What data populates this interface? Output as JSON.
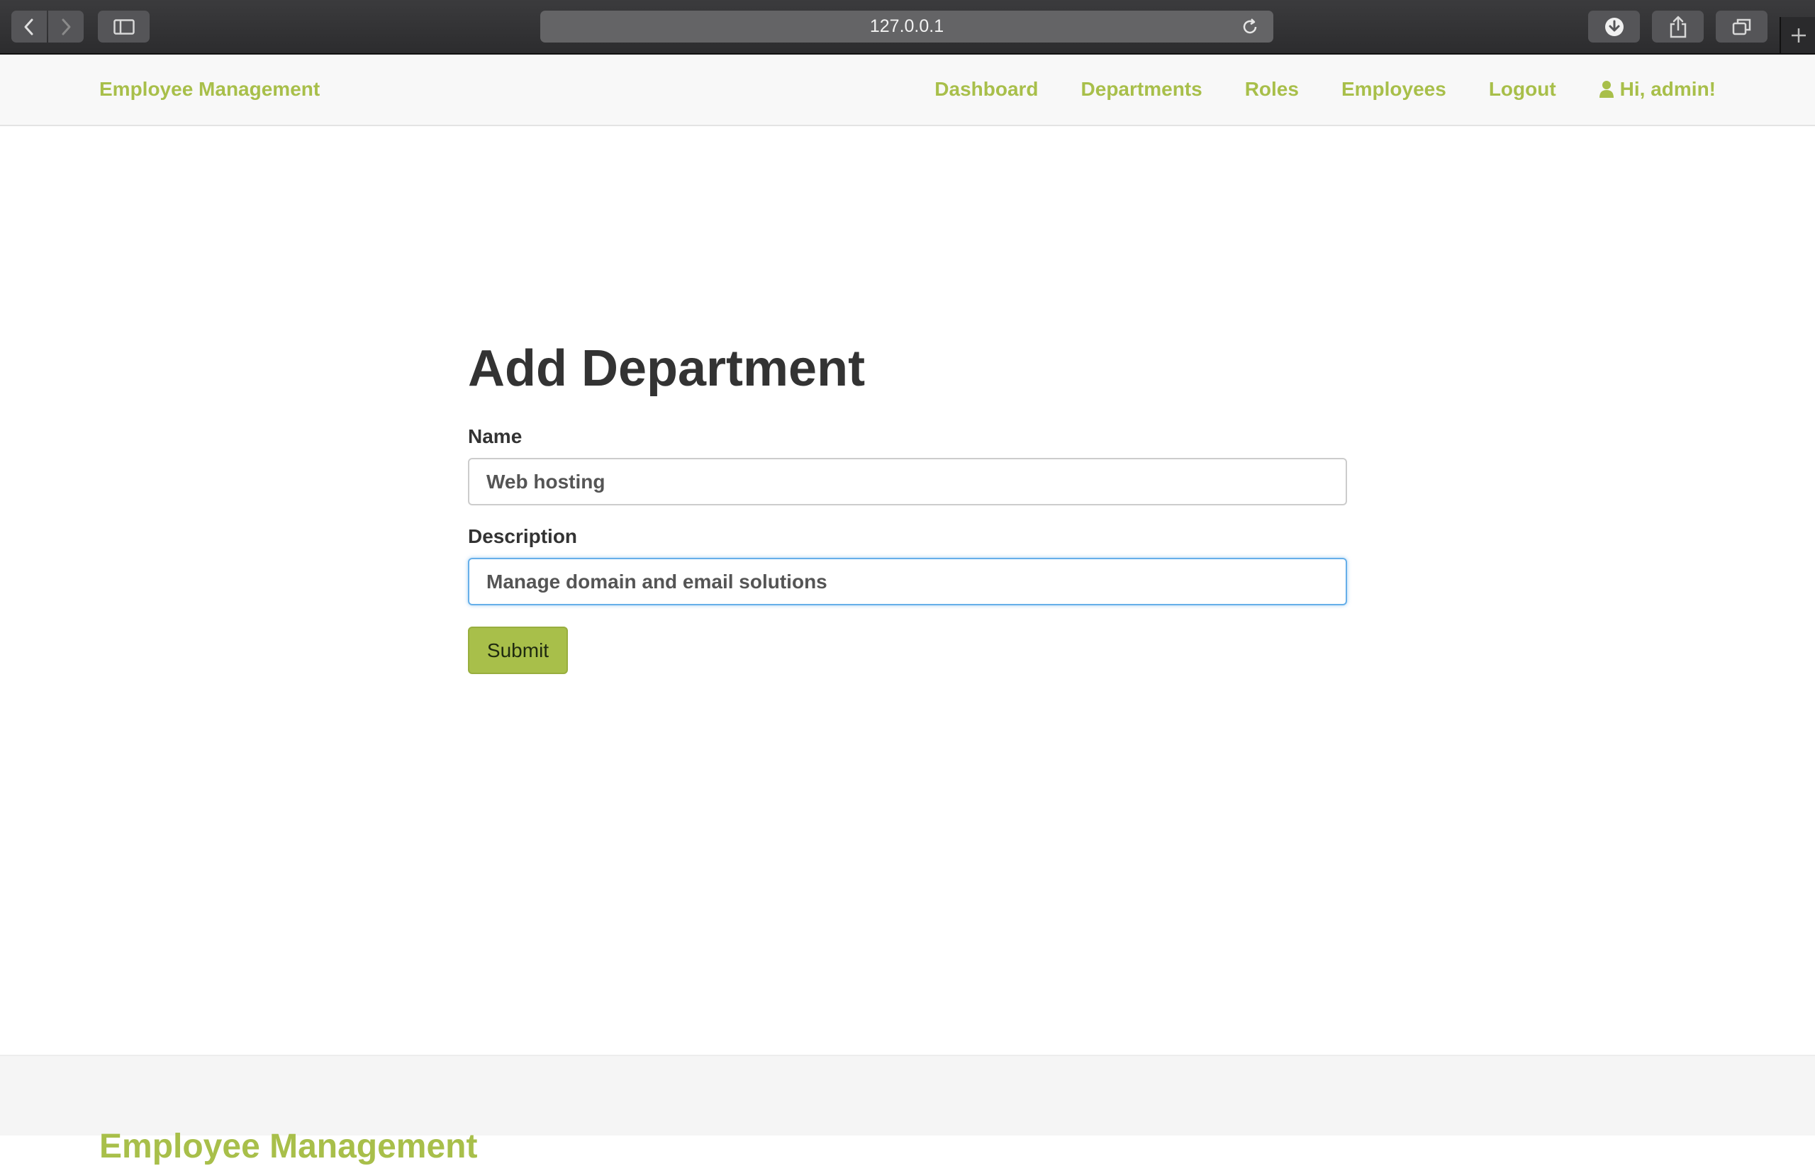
{
  "browser": {
    "url": "127.0.0.1"
  },
  "navbar": {
    "brand": "Employee Management",
    "links": [
      {
        "label": "Dashboard"
      },
      {
        "label": "Departments"
      },
      {
        "label": "Roles"
      },
      {
        "label": "Employees"
      },
      {
        "label": "Logout"
      }
    ],
    "user_greeting": "Hi, admin!",
    "user_icon": "user-icon",
    "accent_color": "#a8bf4a"
  },
  "form": {
    "title": "Add Department",
    "name_label": "Name",
    "name_value": "Web hosting",
    "description_label": "Description",
    "description_value": "Manage domain and email solutions",
    "submit_label": "Submit"
  },
  "footer": {
    "brand": "Employee Management"
  }
}
